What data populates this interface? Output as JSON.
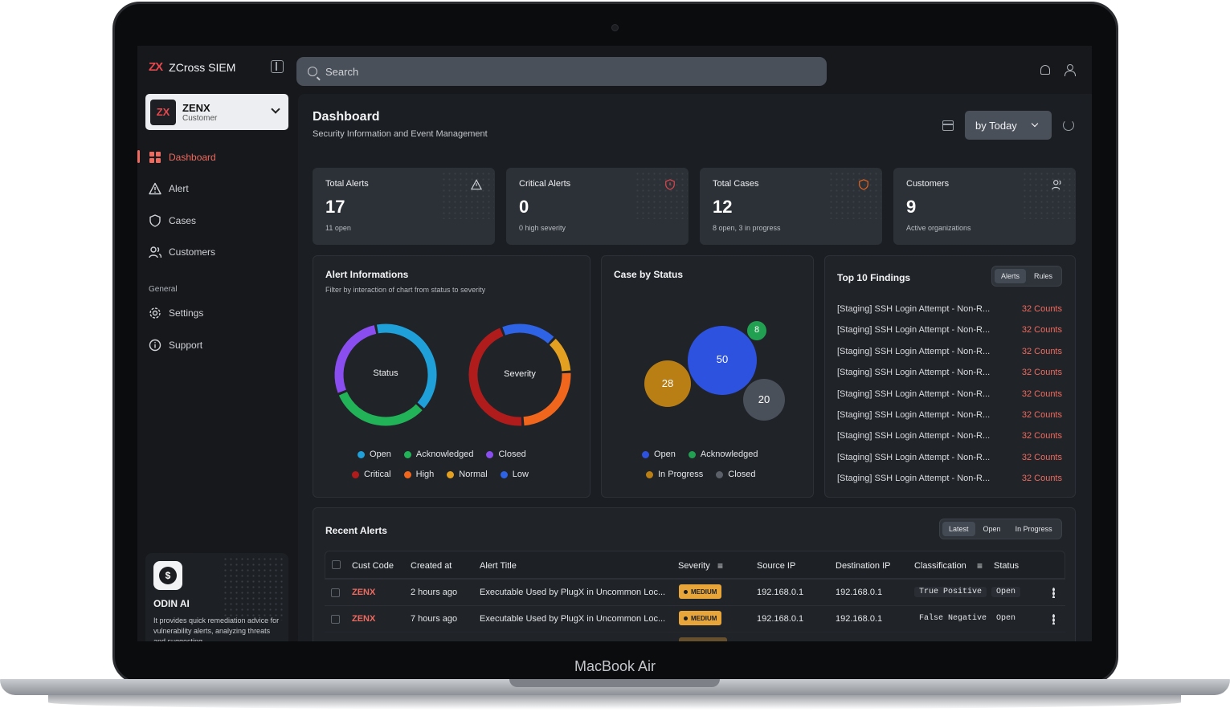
{
  "app": {
    "name": "ZCross SIEM",
    "logo_mark": "ZX"
  },
  "tenant": {
    "logo": "ZX",
    "name": "ZENX",
    "role": "Customer"
  },
  "nav": {
    "items": [
      {
        "label": "Dashboard",
        "icon": "grid-icon"
      },
      {
        "label": "Alert",
        "icon": "warning-icon"
      },
      {
        "label": "Cases",
        "icon": "shield-icon"
      },
      {
        "label": "Customers",
        "icon": "users-icon"
      }
    ],
    "general_label": "General",
    "general": [
      {
        "label": "Settings",
        "icon": "gear-icon"
      },
      {
        "label": "Support",
        "icon": "info-icon"
      }
    ]
  },
  "odin": {
    "title": "ODIN AI",
    "description": "It provides quick remediation advice for vulnerability alerts, analyzing threats and suggesting..."
  },
  "search": {
    "placeholder": "Search"
  },
  "header": {
    "title": "Dashboard",
    "subtitle": "Security Information and Event Management",
    "range": "by Today"
  },
  "stats": [
    {
      "label": "Total Alerts",
      "value": "17",
      "sub": "11 open",
      "icon": "warning-icon"
    },
    {
      "label": "Critical Alerts",
      "value": "0",
      "sub": "0 high severity",
      "icon": "shield-alert-icon"
    },
    {
      "label": "Total Cases",
      "value": "12",
      "sub": "8 open, 3 in progress",
      "icon": "shield-icon"
    },
    {
      "label": "Customers",
      "value": "9",
      "sub": "Active organizations",
      "icon": "users-icon"
    }
  ],
  "alert_info": {
    "title": "Alert Informations",
    "subtitle": "Filter by interaction of chart from status to severity",
    "status_label": "Status",
    "severity_label": "Severity",
    "status_legend": [
      {
        "label": "Open",
        "color": "#1fa0d8"
      },
      {
        "label": "Acknowledged",
        "color": "#22b258"
      },
      {
        "label": "Closed",
        "color": "#8a4df0"
      }
    ],
    "severity_legend": [
      {
        "label": "Critical",
        "color": "#b01c1c"
      },
      {
        "label": "High",
        "color": "#f0661c"
      },
      {
        "label": "Normal",
        "color": "#e4a020"
      },
      {
        "label": "Low",
        "color": "#2e63e6"
      }
    ],
    "status_ring": [
      {
        "label": "Open",
        "value": 40,
        "color": "#1fa0d8"
      },
      {
        "label": "Acknowledged",
        "value": 32,
        "color": "#22b258"
      },
      {
        "label": "Closed",
        "value": 28,
        "color": "#8a4df0"
      }
    ],
    "severity_ring": [
      {
        "label": "Low",
        "value": 18,
        "color": "#2e63e6"
      },
      {
        "label": "Normal",
        "value": 12,
        "color": "#e4a020"
      },
      {
        "label": "High",
        "value": 25,
        "color": "#f0661c"
      },
      {
        "label": "Critical",
        "value": 45,
        "color": "#b01c1c"
      }
    ]
  },
  "case_status": {
    "title": "Case by Status",
    "bubbles": [
      {
        "label": "Open",
        "value": "50",
        "color": "#2e52e0"
      },
      {
        "label": "In Progress",
        "value": "28",
        "color": "#b97e14"
      },
      {
        "label": "Closed",
        "value": "20",
        "color": "#4a5059"
      },
      {
        "label": "Acknowledged",
        "value": "8",
        "color": "#22a052"
      }
    ],
    "legend": [
      {
        "label": "Open",
        "color": "#2e52e0"
      },
      {
        "label": "Acknowledged",
        "color": "#22a052"
      },
      {
        "label": "In Progress",
        "color": "#b97e14"
      },
      {
        "label": "Closed",
        "color": "#5b6068"
      }
    ]
  },
  "findings": {
    "title": "Top 10 Findings",
    "tabs": [
      "Alerts",
      "Rules"
    ],
    "items": [
      {
        "title": "[Staging] SSH Login Attempt - Non-R...",
        "count": "32 Counts"
      },
      {
        "title": "[Staging] SSH Login Attempt - Non-R...",
        "count": "32 Counts"
      },
      {
        "title": "[Staging] SSH Login Attempt - Non-R...",
        "count": "32 Counts"
      },
      {
        "title": "[Staging] SSH Login Attempt - Non-R...",
        "count": "32 Counts"
      },
      {
        "title": "[Staging] SSH Login Attempt - Non-R...",
        "count": "32 Counts"
      },
      {
        "title": "[Staging] SSH Login Attempt - Non-R...",
        "count": "32 Counts"
      },
      {
        "title": "[Staging] SSH Login Attempt - Non-R...",
        "count": "32 Counts"
      },
      {
        "title": "[Staging] SSH Login Attempt - Non-R...",
        "count": "32 Counts"
      },
      {
        "title": "[Staging] SSH Login Attempt - Non-R...",
        "count": "32 Counts"
      }
    ]
  },
  "recent": {
    "title": "Recent Alerts",
    "tabs": [
      "Latest",
      "Open",
      "In Progress"
    ],
    "columns": [
      "Cust Code",
      "Created at",
      "Alert Title",
      "Severity",
      "Source IP",
      "Destination IP",
      "Classification",
      "Status"
    ],
    "rows": [
      {
        "cust": "ZENX",
        "created": "2 hours ago",
        "title": "Executable Used by PlugX in Uncommon Loc...",
        "severity": "MEDIUM",
        "src": "192.168.0.1",
        "dst": "192.168.0.1",
        "class": "True Positive",
        "status": "Open"
      },
      {
        "cust": "ZENX",
        "created": "7 hours ago",
        "title": "Executable Used by PlugX in Uncommon Loc...",
        "severity": "MEDIUM",
        "src": "192.168.0.1",
        "dst": "192.168.0.1",
        "class": "False Negative",
        "status": "Open"
      }
    ]
  },
  "device": {
    "label": "MacBook Air"
  }
}
